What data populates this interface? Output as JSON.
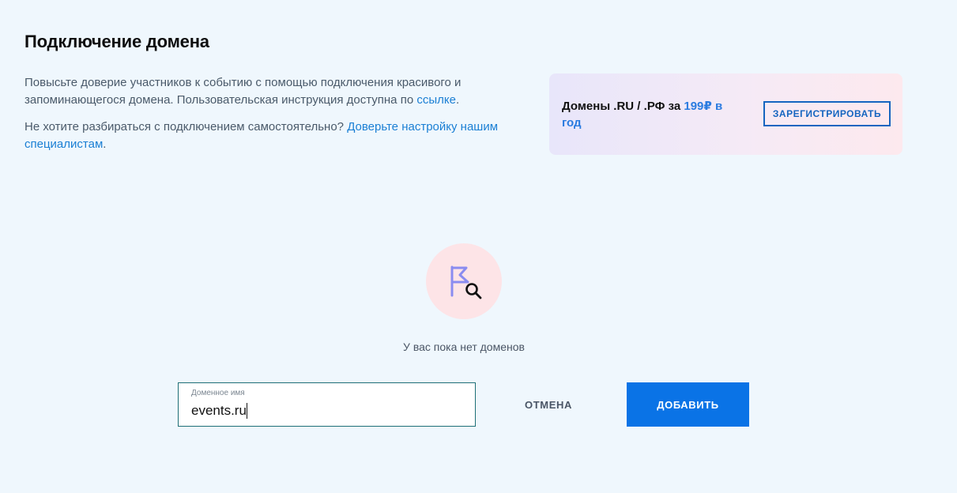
{
  "page": {
    "title": "Подключение домена"
  },
  "intro": {
    "p1_text": "Повысьте доверие участников к событию с помощью подключения красивого и запоминающегося домена. Пользовательская инструкция доступна по ",
    "p1_link": "ссылке",
    "p1_end": ".",
    "p2_text": "Не хотите разбираться с подключением самостоятельно? ",
    "p2_link": "Доверьте настройку нашим специалистам",
    "p2_end": "."
  },
  "promo": {
    "text_prefix": "Домены .RU / .РФ за ",
    "price": "199₽ в год",
    "register_label": "ЗАРЕГИСТРИРОВАТЬ"
  },
  "empty_state": {
    "icon": "flag-search-icon",
    "message": "У вас пока нет доменов"
  },
  "domain_form": {
    "field_label": "Доменное имя",
    "field_value": "events.ru",
    "cancel_label": "ОТМЕНА",
    "add_label": "ДОБАВИТЬ"
  },
  "colors": {
    "background": "#eff7fd",
    "link": "#1a7fd4",
    "primary": "#0a73e6",
    "icon_circle": "#fde4e7",
    "field_border": "#1d6e76"
  }
}
